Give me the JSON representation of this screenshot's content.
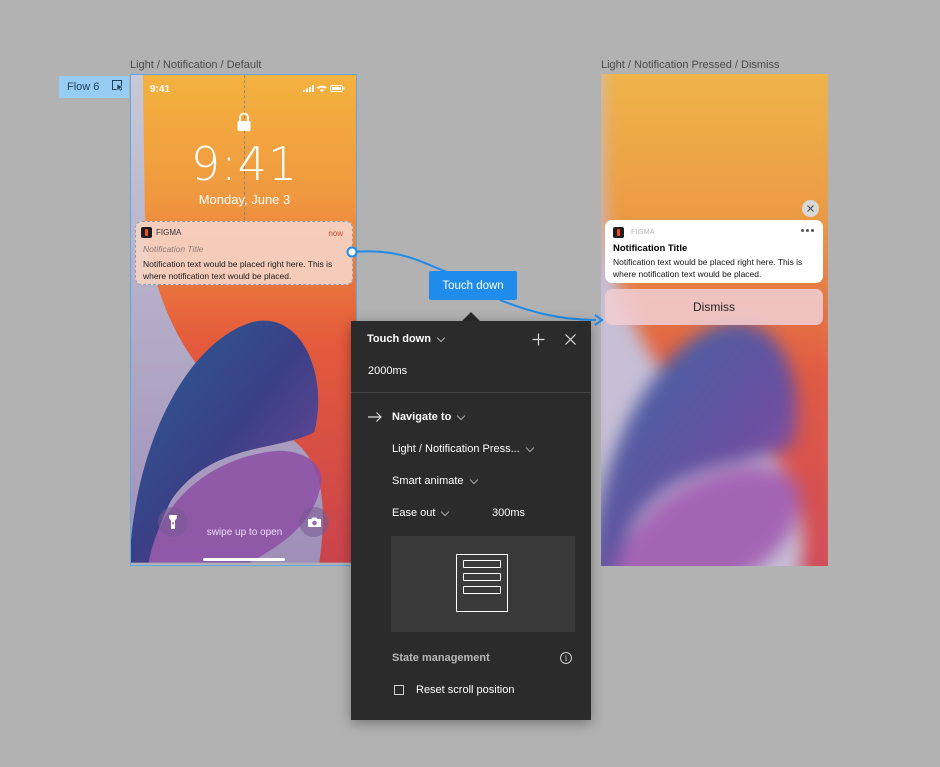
{
  "frames": {
    "left_label": "Light / Notification / Default",
    "right_label": "Light / Notification Pressed / Dismiss"
  },
  "flow": {
    "label": "Flow 6"
  },
  "lockscreen": {
    "status_time": "9:41",
    "time": "9:41",
    "date": "Monday, June 3",
    "swipe_hint": "swipe up to open"
  },
  "notification_default": {
    "app": "FIGMA",
    "when": "now",
    "title": "Notification Title",
    "text": "Notification text would be placed right here. This is where notification text would be placed."
  },
  "notification_pressed": {
    "app": "FIGMA",
    "title": "Notification Title",
    "text": "Notification text would be placed right here. This is where notification text would be placed.",
    "dismiss_label": "Dismiss"
  },
  "connector": {
    "trigger_label": "Touch down"
  },
  "panel": {
    "trigger": "Touch down",
    "delay": "2000ms",
    "action": "Navigate to",
    "destination": "Light / Notification Press...",
    "animation": "Smart animate",
    "easing": "Ease out",
    "duration": "300ms",
    "state_section": "State management",
    "reset_scroll_label": "Reset scroll position",
    "reset_scroll_checked": false
  },
  "colors": {
    "canvas": "#b2b2b2",
    "accent": "#1f8ceb",
    "panel_bg": "#2b2b2b",
    "flow_tag": "#98cdf3"
  },
  "icons": [
    "play-flow-icon",
    "lock-icon",
    "signal-icon",
    "wifi-icon",
    "battery-icon",
    "flashlight-icon",
    "camera-icon",
    "figma-app-icon",
    "close-icon",
    "more-icon",
    "plus-icon",
    "arrow-right-icon",
    "chevron-down-icon",
    "info-icon"
  ]
}
